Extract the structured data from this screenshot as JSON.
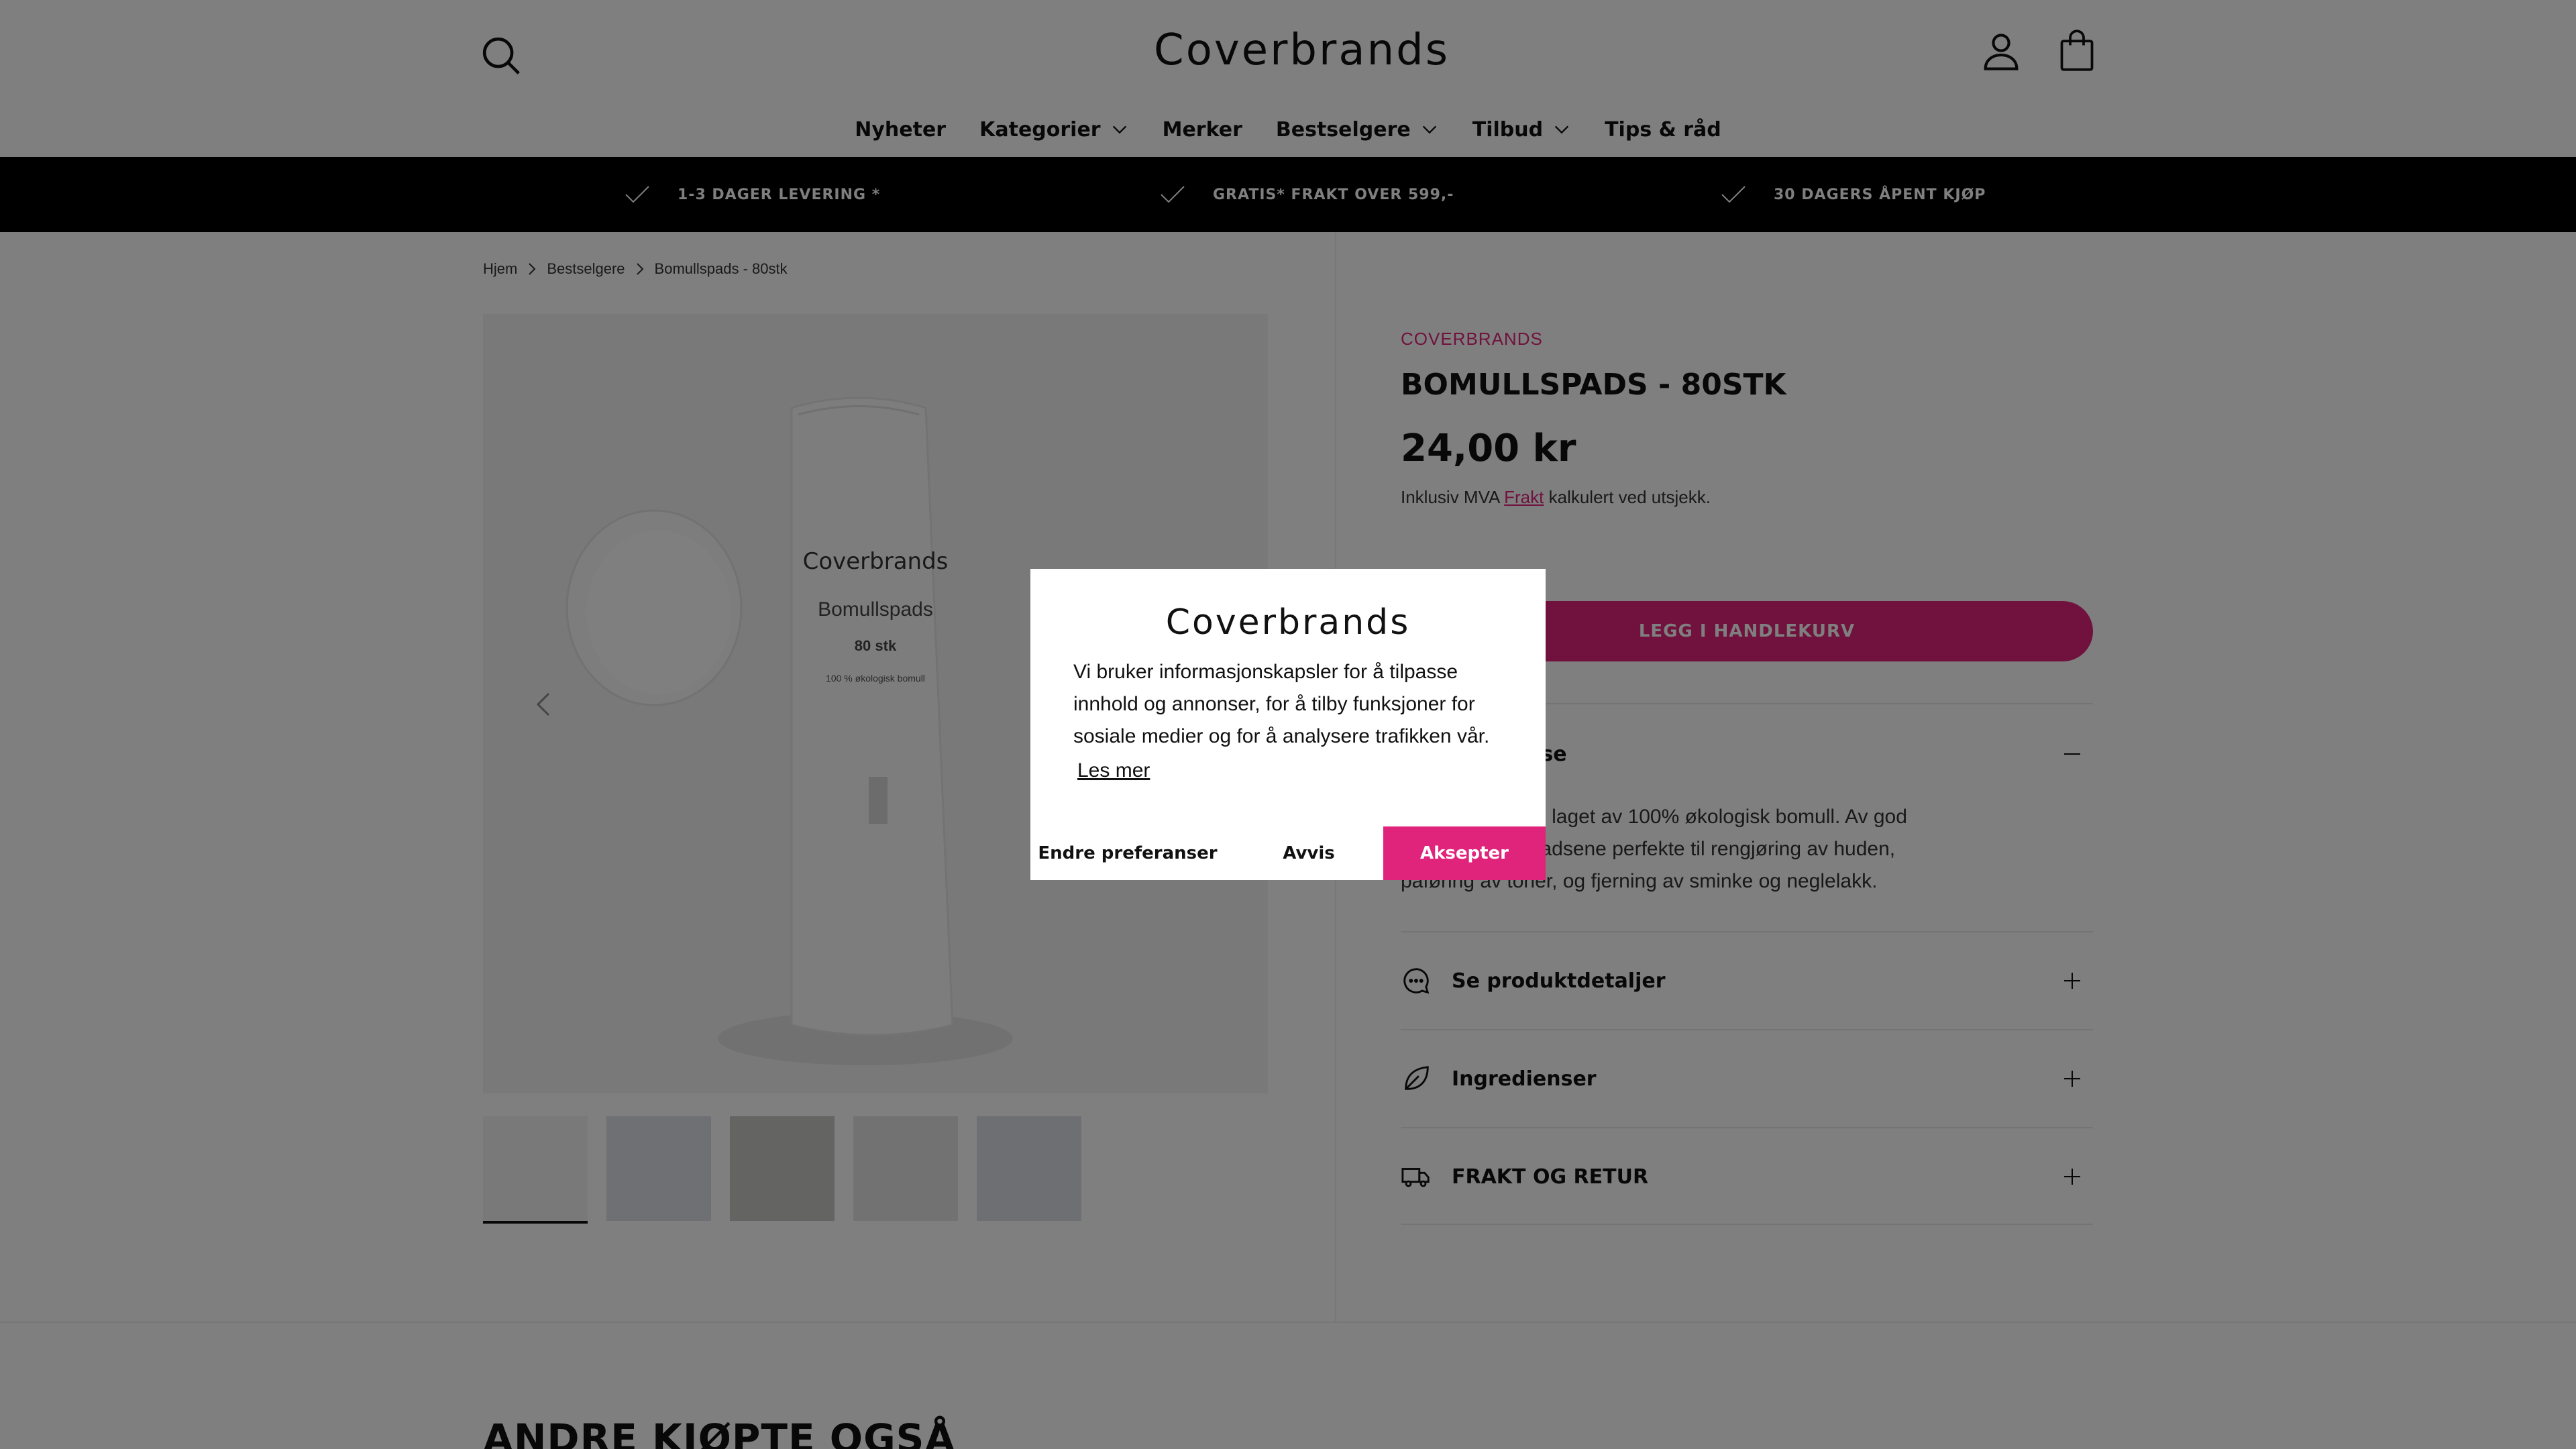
{
  "header": {
    "logo": "Coverbrands",
    "nav": [
      {
        "label": "Nyheter"
      },
      {
        "label": "Kategorier"
      },
      {
        "label": "Merker"
      },
      {
        "label": "Bestselgere"
      },
      {
        "label": "Tilbud"
      },
      {
        "label": "Tips & råd"
      }
    ]
  },
  "announcements": [
    "1-3 DAGER LEVERING *",
    "GRATIS* FRAKT OVER 599,-",
    "30 DAGERS ÅPENT KJØP"
  ],
  "breadcrumb": [
    "Hjem",
    "Bestselgere",
    "Bomullspads - 80stk"
  ],
  "product": {
    "brand": "COVERBRANDS",
    "title": "BOMULLSPADS - 80STK",
    "price": "24,00 kr",
    "tax_prefix": "Inklusiv MVA",
    "tax_link": "Frakt",
    "tax_suffix": "kalkulert ved utsjekk.",
    "add_to_cart": "LEGG I HANDLEKURV",
    "image_text": {
      "brand": "Coverbrands",
      "name": "Bomullspads",
      "count": "80 stk",
      "note": "100 % økologisk bomull"
    },
    "thumbnail_count": 5,
    "accordions": [
      {
        "label": "Produktbeskrivelse",
        "visible_label": "eskrivelse",
        "icon": "text-icon",
        "open": true
      },
      {
        "label": "Se produktdetaljer",
        "icon": "chat-icon",
        "open": false
      },
      {
        "label": "Ingredienser",
        "icon": "leaf-icon",
        "open": false
      },
      {
        "label": "FRAKT OG RETUR",
        "icon": "truck-icon",
        "open": false
      }
    ],
    "description_line1": "ige bomullspads laget av 100% økologisk bomull. Av god",
    "description_line2": "et overflate er padsene perfekte til rengjøring av huden,",
    "description_line3": "påføring av toner, og fjerning av sminke og neglelakk."
  },
  "section_below": {
    "title": "ANDRE KJØPTE OGSÅ"
  },
  "cookie_modal": {
    "logo": "Coverbrands",
    "text": "Vi bruker informasjonskapsler for å tilpasse innhold og annonser, for å tilby funksjoner for sosiale medier og for å analysere trafikken vår.",
    "link": "Les mer",
    "preferences": "Endre preferanser",
    "reject": "Avvis",
    "accept": "Aksepter"
  },
  "colors": {
    "accent": "#e0247b",
    "bar": "#000000",
    "overlay": "rgba(0,0,0,0.5)"
  }
}
